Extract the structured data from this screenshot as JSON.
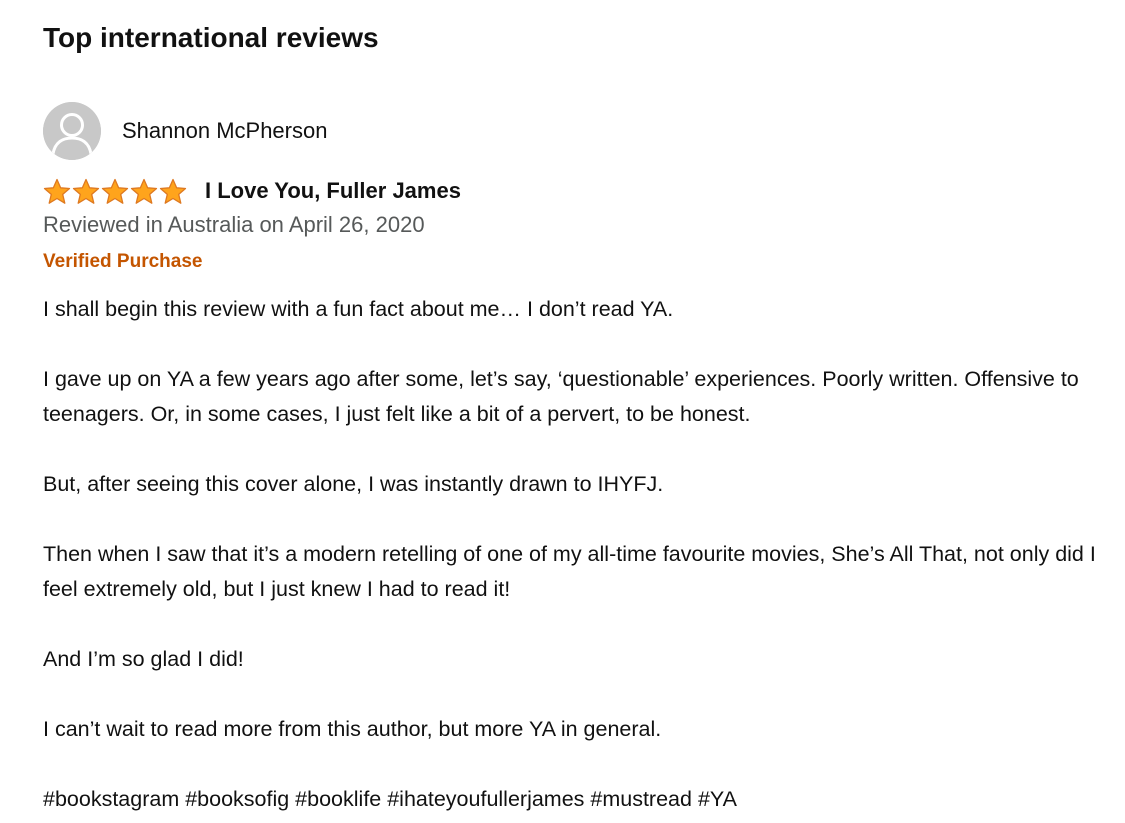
{
  "section": {
    "title": "Top international reviews"
  },
  "review": {
    "reviewer_name": "Shannon McPherson",
    "avatar_icon": "default-user-avatar-icon",
    "rating": {
      "value": 5,
      "max": 5,
      "star_color": "#ffa41c",
      "star_outline": "#de7921"
    },
    "title": "I Love You, Fuller James",
    "date_line": "Reviewed in Australia on April 26, 2020",
    "verified_label": "Verified Purchase",
    "paragraphs": [
      "I shall begin this review with a fun fact about me… I don’t read YA.",
      "I gave up on YA a few years ago after some, let’s say, ‘questionable’ experiences. Poorly written. Offensive to teenagers. Or, in some cases, I just felt like a bit of a pervert, to be honest.",
      "But, after seeing this cover alone, I was instantly drawn to IHYFJ.",
      "Then when I saw that it’s a modern retelling of one of my all-time favourite movies, She’s All That, not only did I feel extremely old, but I just knew I had to read it!",
      "And I’m so glad I did!",
      "I can’t wait to read more from this author, but more YA in general.",
      "#bookstagram #booksofig #booklife #ihateyoufullerjames #mustread #YA"
    ]
  },
  "colors": {
    "text": "#111111",
    "secondary_text": "#565959",
    "verified": "#c45500",
    "avatar_bg": "#c8c8c8"
  }
}
